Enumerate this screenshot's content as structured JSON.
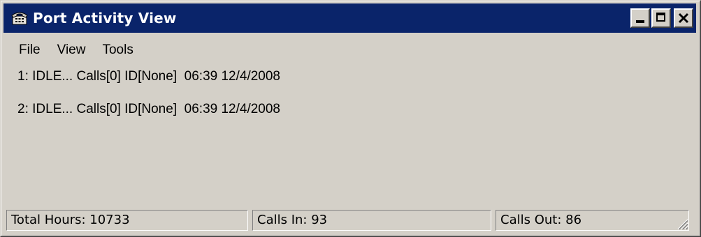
{
  "window": {
    "title": "Port Activity View",
    "icon": "telephone-icon",
    "controls": [
      "minimize-icon",
      "maximize-icon",
      "close-icon"
    ]
  },
  "menu": {
    "items": [
      "File",
      "View",
      "Tools"
    ]
  },
  "ports": [
    {
      "text": "1: IDLE... Calls[0] ID[None]  06:39 12/4/2008"
    },
    {
      "text": "2: IDLE... Calls[0] ID[None]  06:39 12/4/2008"
    }
  ],
  "status": {
    "total_hours": "Total Hours: 10733",
    "calls_in": "Calls In: 93",
    "calls_out": "Calls Out: 86"
  },
  "colors": {
    "titlebar": "#0a246a",
    "face": "#d4d0c8"
  }
}
